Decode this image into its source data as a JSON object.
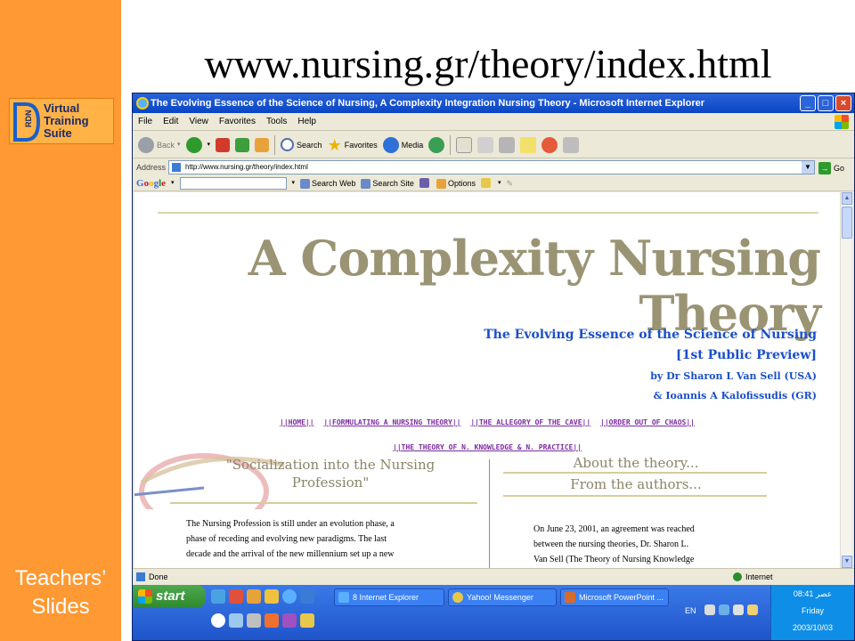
{
  "slide": {
    "title": "www.nursing.gr/theory/index.html",
    "footer": "Teachers’ Slides",
    "logo": {
      "letters": "RDN",
      "line1": "Virtual",
      "line2": "Training",
      "line3": "Suite"
    }
  },
  "window": {
    "title": "The Evolving Essence of the Science of Nursing, A Complexity Integration Nursing Theory - Microsoft Internet Explorer",
    "menu": [
      "File",
      "Edit",
      "View",
      "Favorites",
      "Tools",
      "Help"
    ],
    "toolbar": {
      "back": "Back",
      "search": "Search",
      "favorites": "Favorites",
      "media": "Media"
    },
    "address": {
      "label": "Address",
      "value": "http://www.nursing.gr/theory/index.html",
      "go": "Go"
    },
    "google": {
      "logo": "Google",
      "search_web": "Search Web",
      "search_site": "Search Site",
      "options": "Options"
    },
    "status": {
      "left": "Done",
      "zone": "Internet"
    }
  },
  "page": {
    "title_line1": "A Complexity Nursing",
    "title_line2": "Theory",
    "subtitle1": "The Evolving Essence of the Science of Nursing",
    "subtitle2": "[1st Public Preview]",
    "author1": "by Dr Sharon L Van Sell (USA)",
    "author2": "& Ioannis A Kalofissudis (GR)",
    "nav_row1": [
      "||HOME||",
      "||FORMULATING A NURSING THEORY||",
      "||THE ALLEGORY OF THE CAVE||",
      "||ORDER OUT OF CHAOS||"
    ],
    "nav_row2": [
      "||THE THEORY OF N.  KNOWLEDGE & N. PRACTICE||"
    ],
    "left_heading_line1": "\"Socialization into the Nursing",
    "left_heading_line2": "Profession\"",
    "left_text": [
      "The Nursing Profession is still under an evolution phase, a",
      "phase of receding and evolving new paradigms.  The last",
      "decade and the arrival of the new millennium set up a new"
    ],
    "right_heading1": "About the theory...",
    "right_heading2": "From the authors...",
    "right_text": [
      "On June 23, 2001, an agreement was reached",
      "between the nursing theories, Dr. Sharon L.",
      "Van Sell (The Theory of Nursing Knowledge"
    ]
  },
  "taskbar": {
    "start": "start",
    "tasks": [
      "8 Internet Explorer",
      "Yahoo! Messenger",
      "Microsoft PowerPoint ..."
    ],
    "lang": "EN",
    "clock": {
      "time": "08:41 عصر",
      "day": "Friday",
      "date": "2003/10/03"
    }
  },
  "colors": {
    "sidebar": "#ff9933",
    "title_gray": "#9a9474",
    "link_blue": "#1a4fc8",
    "nav_purple": "#7b2ba0",
    "taskbar": "#2a65de"
  }
}
